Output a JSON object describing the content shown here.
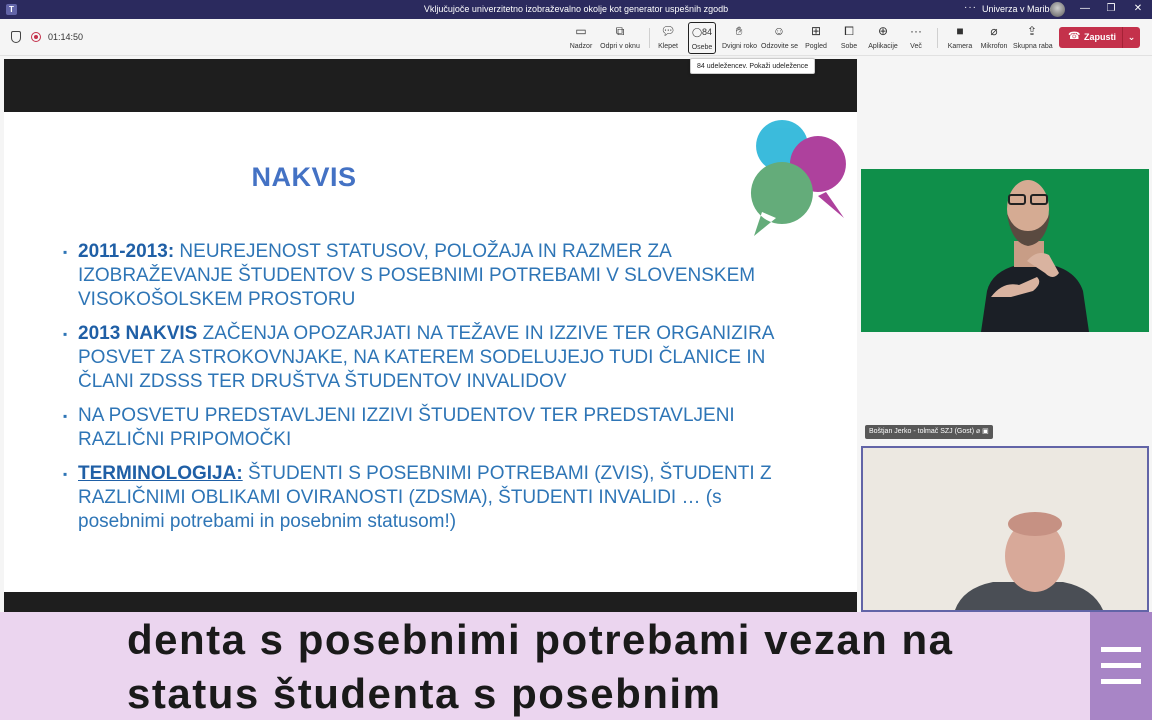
{
  "window": {
    "title": "Vključujoče univerzitetno izobraževalno okolje kot generator uspešnih zgodb",
    "organization": "Univerza v Mariboru",
    "more_label": "···",
    "minimize_glyph": "—",
    "maximize_glyph": "❐",
    "close_glyph": "✕"
  },
  "meeting": {
    "elapsed": "01:14:50",
    "people_count": "84",
    "tooltip": "84 udeležencev. Pokaži udeležence"
  },
  "toolbar": {
    "buttons": [
      {
        "label": "Nadzor",
        "icon": "monitor-icon"
      },
      {
        "label": "Odpri v oknu",
        "icon": "popout-icon"
      },
      {
        "label": "Klepet",
        "icon": "chat-icon"
      },
      {
        "label": "Osebe",
        "icon": "people-icon"
      },
      {
        "label": "Dvigni roko",
        "icon": "raise-hand-icon"
      },
      {
        "label": "Odzovite se",
        "icon": "smile-icon"
      },
      {
        "label": "Pogled",
        "icon": "view-icon"
      },
      {
        "label": "Sobe",
        "icon": "rooms-icon"
      },
      {
        "label": "Aplikacije",
        "icon": "apps-icon"
      },
      {
        "label": "Več",
        "icon": "more-icon"
      },
      {
        "label": "Kamera",
        "icon": "camera-off-icon"
      },
      {
        "label": "Mikrofon",
        "icon": "mic-off-icon"
      },
      {
        "label": "Skupna raba",
        "icon": "share-icon"
      }
    ],
    "leave_label": "Zapusti"
  },
  "slide": {
    "title": "NAKVIS",
    "bullets": [
      {
        "lead": "2011-2013:",
        "text": " NEUREJENOST STATUSOV, POLOŽAJA IN RAZMER ZA IZOBRAŽEVANJE ŠTUDENTOV S POSEBNIMI POTREBAMI V SLOVENSKEM VISOKOŠOLSKEM PROSTORU"
      },
      {
        "lead": "2013 NAKVIS",
        "text": " ZAČENJA OPOZARJATI NA TEŽAVE IN IZZIVE  TER ORGANIZIRA POSVET ZA STROKOVNJAKE, NA KATEREM SODELUJEJO TUDI ČLANICE IN ČLANI ZDSSS TER DRUŠTVA ŠTUDENTOV INVALIDOV"
      },
      {
        "lead": "",
        "text": "NA POSVETU PREDSTAVLJENI IZZIVI ŠTUDENTOV TER PREDSTAVLJENI RAZLIČNI PRIPOMOČKI"
      },
      {
        "lead": "TERMINOLOGIJA:",
        "text": " ŠTUDENTI S POSEBNIMI POTREBAMI (ZVIS), ŠTUDENTI Z RAZLIČNIMI OBLIKAMI OVIRANOSTI (ZDSMA), ŠTUDENTI INVALIDI … (s posebnimi potrebami in posebnim statusom!)"
      }
    ]
  },
  "participants": {
    "interpreter_name": "Boštjan Jerko - tolmač SZJ (Gost)"
  },
  "captions": {
    "line1": "denta s posebnimi potrebami vezan na",
    "line2": "status študenta s posebnim"
  },
  "colors": {
    "titlebar": "#2b2a5e",
    "leave": "#c4314b",
    "slide_title": "#4472c4",
    "slide_text": "#2e75b6",
    "captions_bg": "#ebd5ef",
    "caption_menu": "#a885c6"
  }
}
